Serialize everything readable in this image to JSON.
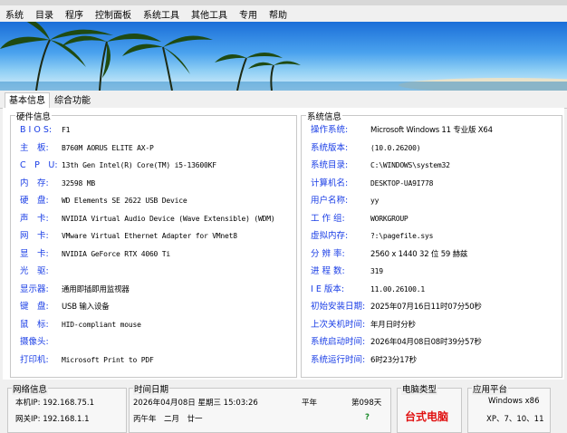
{
  "menu": [
    "系统",
    "目录",
    "程序",
    "控制面板",
    "系统工具",
    "其他工具",
    "专用",
    "帮助"
  ],
  "tabs": {
    "basic": "基本信息",
    "combined": "综合功能"
  },
  "hardware": {
    "legend": "硬件信息",
    "rows": [
      {
        "label": "B I O S:",
        "value": "F1"
      },
      {
        "label": "主　板:",
        "value": "B760M AORUS ELITE AX-P"
      },
      {
        "label": "C　P　U:",
        "value": "13th Gen Intel(R) Core(TM) i5-13600KF"
      },
      {
        "label": "内　存:",
        "value": "32598 MB"
      },
      {
        "label": "硬　盘:",
        "value": "WD Elements SE 2622 USB Device"
      },
      {
        "label": "声　卡:",
        "value": "NVIDIA Virtual Audio Device (Wave Extensible) (WDM)"
      },
      {
        "label": "网　卡:",
        "value": "VMware Virtual Ethernet Adapter for VMnet8"
      },
      {
        "label": "显　卡:",
        "value": "NVIDIA GeForce RTX 4060 Ti"
      },
      {
        "label": "光　驱:",
        "value": ""
      },
      {
        "label": "显示器:",
        "value": "通用即插即用监视器"
      },
      {
        "label": "键　盘:",
        "value": "USB 输入设备"
      },
      {
        "label": "鼠　标:",
        "value": "HID-compliant mouse"
      },
      {
        "label": "摄像头:",
        "value": ""
      },
      {
        "label": "打印机:",
        "value": "Microsoft Print to PDF"
      }
    ]
  },
  "system": {
    "legend": "系统信息",
    "rows": [
      {
        "label": "操作系统:",
        "value": "Microsoft Windows 11 专业版 X64"
      },
      {
        "label": "系统版本:",
        "value": "(10.0.26200)"
      },
      {
        "label": "系统目录:",
        "value": "C:\\WINDOWS\\system32"
      },
      {
        "label": "计算机名:",
        "value": "DESKTOP-UA9I778"
      },
      {
        "label": "用户名称:",
        "value": "yy"
      },
      {
        "label": "工 作 组:",
        "value": "WORKGROUP"
      },
      {
        "label": "虚拟内存:",
        "value": "?:\\pagefile.sys"
      },
      {
        "label": "分 辨 率:",
        "value": "2560 x 1440 32 位 59 赫兹"
      },
      {
        "label": "进 程 数:",
        "value": "319"
      },
      {
        "label": "I E 版本:",
        "value": "11.00.26100.1"
      },
      {
        "label": "初始安装日期:",
        "value": "2025年07月16日11时07分50秒"
      },
      {
        "label": "上次关机时间:",
        "value": "年月日时分秒"
      },
      {
        "label": "系统启动时间:",
        "value": "2026年04月08日08时39分57秒"
      },
      {
        "label": "系统运行时间:",
        "value": "6时23分17秒"
      }
    ]
  },
  "network": {
    "legend": "网络信息",
    "local_ip": "本机IP: 192.168.75.1",
    "gateway_ip": "网关IP: 192.168.1.1"
  },
  "datetime": {
    "legend": "时间日期",
    "now": "2026年04月08日 星期三 15:03:26",
    "year_type": "平年",
    "week": "第098天",
    "lunar": "丙午年　二月　廿一",
    "mark": "?"
  },
  "pc_type": {
    "legend": "电脑类型",
    "value": "台式电脑"
  },
  "platform": {
    "legend": "应用平台",
    "line1": "Windows x86",
    "line2": "XP、7、10、11"
  },
  "colors": {
    "label_blue": "#1a3ee6",
    "alert_red": "#e01010"
  }
}
